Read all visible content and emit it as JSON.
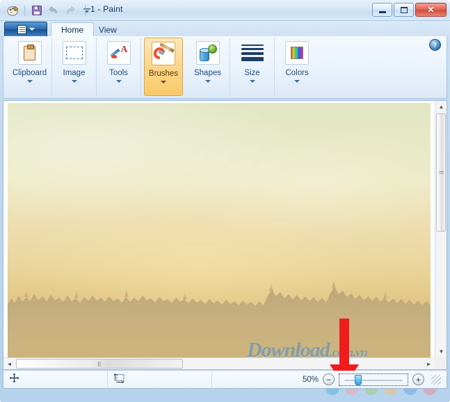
{
  "window": {
    "title": "1 - Paint",
    "quick_access": [
      {
        "name": "paint-logo-icon",
        "label": "Paint"
      },
      {
        "name": "save-icon",
        "label": "Save"
      },
      {
        "name": "undo-icon",
        "label": "Undo"
      },
      {
        "name": "redo-icon",
        "label": "Redo"
      },
      {
        "name": "customize-quick-access-icon",
        "label": "Customize Quick Access Toolbar"
      }
    ],
    "controls": {
      "minimize": "Minimize",
      "maximize": "Maximize",
      "close": "✕"
    },
    "help_label": "?"
  },
  "ribbon": {
    "menu_button_label": "File",
    "tabs": [
      {
        "label": "Home",
        "active": true
      },
      {
        "label": "View",
        "active": false
      }
    ],
    "groups": [
      {
        "label": "Clipboard",
        "icon": "clipboard-icon",
        "highlighted": false,
        "caret": true
      },
      {
        "label": "Image",
        "icon": "selection-rectangle-icon",
        "highlighted": false,
        "caret": true
      },
      {
        "label": "Tools",
        "icon": "pencil-text-tools-icon",
        "highlighted": false,
        "caret": true
      },
      {
        "label": "Brushes",
        "icon": "paintbrush-icon",
        "highlighted": true,
        "caret": true
      },
      {
        "label": "Shapes",
        "icon": "shapes-icon",
        "highlighted": false,
        "caret": true
      },
      {
        "label": "Size",
        "icon": "line-thickness-icon",
        "highlighted": false,
        "caret": true
      },
      {
        "label": "Colors",
        "icon": "color-palette-icon",
        "highlighted": false,
        "caret": true
      }
    ]
  },
  "canvas": {
    "image_description": "hazy sunset landscape with pine tree silhouette horizon",
    "watermark": {
      "main": "Download",
      "suffix": ".com.vn"
    },
    "watermark_dot_colors": [
      "#5bb4e0",
      "#f0a6b4",
      "#9fd17a",
      "#f3c46a",
      "#6aa9e0",
      "#ef8f8f"
    ],
    "vertical_scrollbar": {
      "up": "▲",
      "down": "▼"
    },
    "horizontal_scrollbar": {
      "left": "◄",
      "right": "►"
    }
  },
  "annotation": {
    "arrow_color": "#ee1c1c",
    "points_to": "zoom-out-button"
  },
  "status_bar": {
    "cursor_position_icon": "cursor-position-icon",
    "selection_size_icon": "selection-size-icon",
    "zoom_level": "50%",
    "zoom_out_label": "−",
    "zoom_in_label": "+"
  }
}
